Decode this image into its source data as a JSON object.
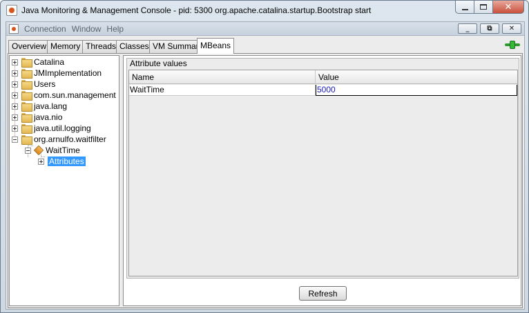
{
  "window": {
    "title": "Java Monitoring & Management Console - pid: 5300 org.apache.catalina.startup.Bootstrap start",
    "minimize_glyph": "–",
    "maximize_glyph": "□",
    "close_glyph": "✕"
  },
  "menubar": {
    "items": [
      "Connection",
      "Window",
      "Help"
    ],
    "frame_minimize_glyph": "_",
    "frame_restore_glyph": "⧉",
    "frame_close_glyph": "✕"
  },
  "tabs": [
    {
      "label": "Overview",
      "active": false
    },
    {
      "label": "Memory",
      "active": false
    },
    {
      "label": "Threads",
      "active": false
    },
    {
      "label": "Classes",
      "active": false
    },
    {
      "label": "VM Summary",
      "active": false
    },
    {
      "label": "MBeans",
      "active": true
    }
  ],
  "icons": {
    "window_icon": "java-icon",
    "connection_status": "connected-plug-icon",
    "folder": "folder-icon",
    "mbean": "mbean-icon"
  },
  "tree": {
    "items": [
      {
        "label": "Catalina",
        "expanded": false
      },
      {
        "label": "JMImplementation",
        "expanded": false
      },
      {
        "label": "Users",
        "expanded": false
      },
      {
        "label": "com.sun.management",
        "expanded": false
      },
      {
        "label": "java.lang",
        "expanded": false
      },
      {
        "label": "java.nio",
        "expanded": false
      },
      {
        "label": "java.util.logging",
        "expanded": false
      },
      {
        "label": "org.arnulfo.waitfilter",
        "expanded": true
      }
    ],
    "bean": {
      "label": "WaitTime",
      "expanded": true
    },
    "attributes": {
      "label": "Attributes",
      "selected": true
    }
  },
  "attributes_panel": {
    "legend": "Attribute values",
    "columns": [
      "Name",
      "Value"
    ],
    "rows": [
      {
        "name": "WaitTime",
        "value": "5000"
      }
    ],
    "refresh_label": "Refresh"
  },
  "colors": {
    "selection": "#3399ff",
    "value_text": "#1a1ac0",
    "connected": "#2e9a2e"
  }
}
